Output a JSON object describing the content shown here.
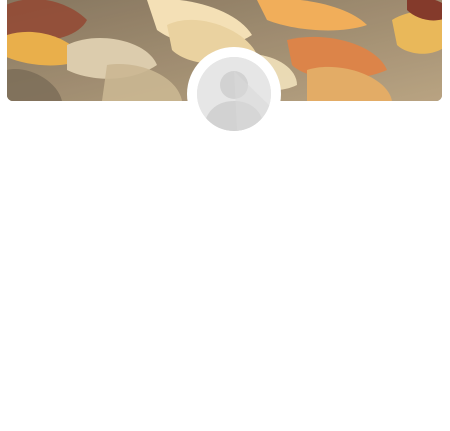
{
  "profile": {
    "cover_image": "autumn-leaves-photo",
    "avatar_icon": "default-user-silhouette-icon"
  },
  "colors": {
    "background": "#ffffff",
    "avatar_bg": "#e6e6e6",
    "avatar_silhouette": "#d2d2d2"
  }
}
